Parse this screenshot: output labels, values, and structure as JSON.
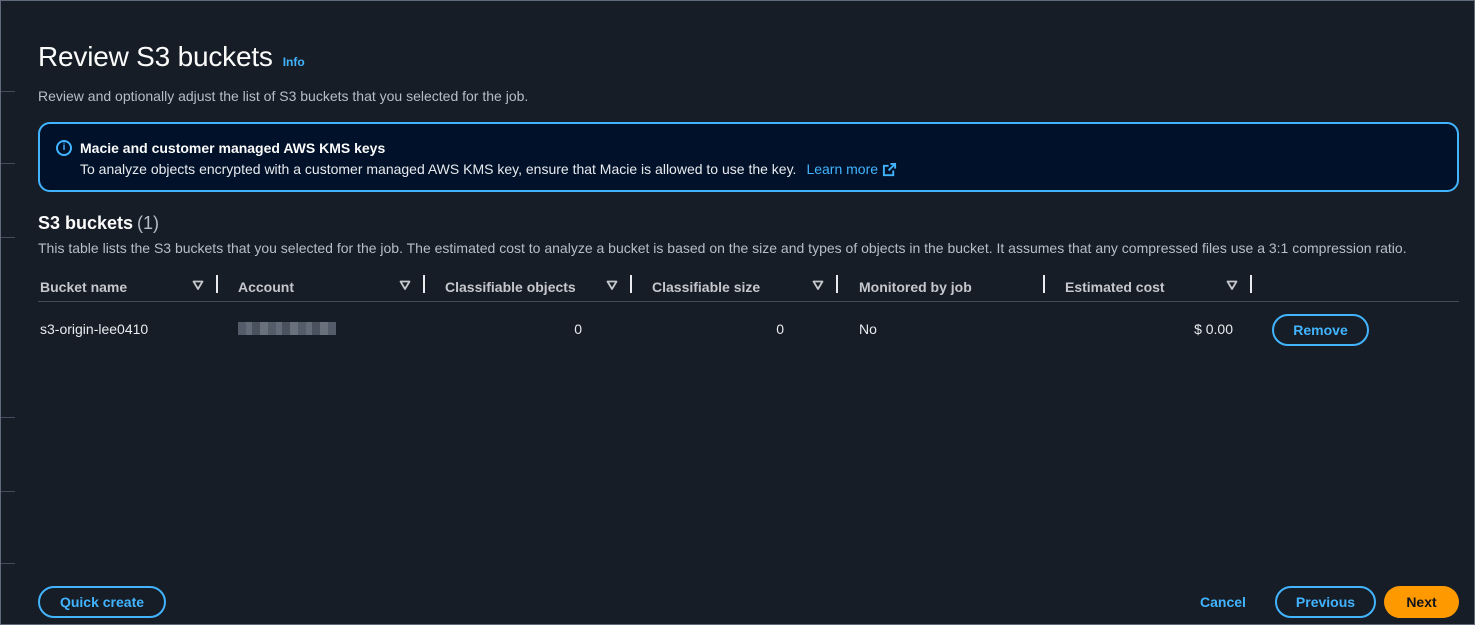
{
  "page": {
    "title": "Review S3 buckets",
    "info_label": "Info",
    "description": "Review and optionally adjust the list of S3 buckets that you selected for the job."
  },
  "alert": {
    "title": "Macie and customer managed AWS KMS keys",
    "body": "To analyze objects encrypted with a customer managed AWS KMS key, ensure that Macie is allowed to use the key.",
    "link_label": "Learn more",
    "icon": "info-circle-icon"
  },
  "section": {
    "title": "S3 buckets",
    "count": "(1)",
    "description": "This table lists the S3 buckets that you selected for the job. The estimated cost to analyze a bucket is based on the size and types of objects in the bucket. It assumes that any compressed files use a 3:1 compression ratio."
  },
  "table": {
    "columns": [
      {
        "label": "Bucket name",
        "sortable": true
      },
      {
        "label": "Account",
        "sortable": true
      },
      {
        "label": "Classifiable objects",
        "sortable": true
      },
      {
        "label": "Classifiable size",
        "sortable": true
      },
      {
        "label": "Monitored by job",
        "sortable": false
      },
      {
        "label": "Estimated cost",
        "sortable": true
      }
    ],
    "rows": [
      {
        "bucket_name": "s3-origin-lee0410",
        "account": "",
        "classifiable_objects": "0",
        "classifiable_size": "0",
        "monitored_by_job": "No",
        "estimated_cost": "$ 0.00",
        "action_label": "Remove"
      }
    ]
  },
  "footer": {
    "quick_create_label": "Quick create",
    "cancel_label": "Cancel",
    "previous_label": "Previous",
    "next_label": "Next"
  },
  "colors": {
    "background": "#161d26",
    "accent": "#42b4ff",
    "primary_button": "#ff9900",
    "alert_background": "#001129"
  }
}
